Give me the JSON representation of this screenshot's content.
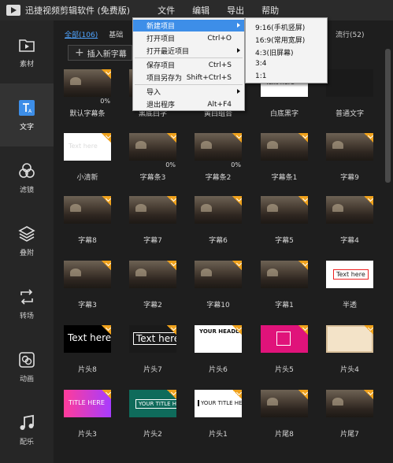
{
  "app": {
    "title": "迅捷视频剪辑软件 (免费版)"
  },
  "menu": [
    "文件",
    "编辑",
    "导出",
    "帮助"
  ],
  "sidebar": [
    {
      "label": "素材",
      "icon": "media-icon"
    },
    {
      "label": "文字",
      "icon": "text-icon",
      "active": true
    },
    {
      "label": "滤镜",
      "icon": "filter-icon"
    },
    {
      "label": "叠附",
      "icon": "overlay-icon"
    },
    {
      "label": "转场",
      "icon": "transition-icon"
    },
    {
      "label": "动画",
      "icon": "animation-icon"
    },
    {
      "label": "配乐",
      "icon": "music-icon"
    }
  ],
  "tabs": {
    "all": "全部(106)",
    "basic": "基础",
    "popular": "流行(52)"
  },
  "insert_button": "插入新字幕",
  "file_menu": [
    {
      "label": "新建项目",
      "submenu": true,
      "highlighted": true
    },
    {
      "label": "打开项目",
      "shortcut": "Ctrl+O"
    },
    {
      "label": "打开最近项目",
      "submenu": true
    },
    {
      "label": "保存项目",
      "shortcut": "Ctrl+S"
    },
    {
      "label": "项目另存为",
      "shortcut": "Shift+Ctrl+S"
    },
    {
      "label": "导入",
      "submenu": true
    },
    {
      "label": "退出程序",
      "shortcut": "Alt+F4"
    }
  ],
  "new_project_submenu": [
    "9:16(手机竖屏)",
    "16:9(常用宽屏)",
    "4:3(旧屏幕)",
    "3:4",
    "1:1"
  ],
  "tiles": [
    {
      "label": "默认字幕条",
      "style": "scene",
      "badge": true,
      "progress": "0%"
    },
    {
      "label": "黑底白字",
      "style": "scene",
      "badge": false
    },
    {
      "label": "黄白组合",
      "style": "scene",
      "badge": false
    },
    {
      "label": "白底黑字",
      "style": "white",
      "overlay": "Text here",
      "overlay_style": "black",
      "badge": false
    },
    {
      "label": "普通文字",
      "style": "dark",
      "badge": false
    },
    {
      "label": "小清新",
      "style": "white",
      "overlay": "Text here",
      "overlay_style": "light",
      "badge": true
    },
    {
      "label": "字幕条3",
      "style": "scene",
      "badge": true,
      "progress": "0%"
    },
    {
      "label": "字幕条2",
      "style": "scene",
      "badge": true,
      "progress": "0%"
    },
    {
      "label": "字幕条1",
      "style": "scene",
      "badge": true
    },
    {
      "label": "字幕9",
      "style": "scene",
      "badge": true
    },
    {
      "label": "字幕8",
      "style": "scene",
      "badge": true
    },
    {
      "label": "字幕7",
      "style": "scene",
      "badge": true
    },
    {
      "label": "字幕6",
      "style": "scene",
      "badge": true
    },
    {
      "label": "字幕5",
      "style": "scene",
      "badge": true
    },
    {
      "label": "字幕4",
      "style": "scene",
      "badge": true
    },
    {
      "label": "字幕3",
      "style": "scene",
      "badge": true
    },
    {
      "label": "字幕2",
      "style": "scene",
      "badge": true
    },
    {
      "label": "字幕10",
      "style": "scene",
      "badge": true
    },
    {
      "label": "字幕1",
      "style": "scene",
      "badge": true
    },
    {
      "label": "半透",
      "style": "white",
      "overlay": "Text here",
      "overlay_style": "red",
      "badge": false
    },
    {
      "label": "片头8",
      "style": "black",
      "overlay": "Text here",
      "overlay_style": "big",
      "badge": true
    },
    {
      "label": "片头7",
      "style": "dark",
      "overlay": "Text here",
      "overlay_style": "outline-big",
      "badge": true
    },
    {
      "label": "片头6",
      "style": "white",
      "overlay": "YOUR HEADLINE HERE",
      "overlay_style": "stack",
      "badge": true
    },
    {
      "label": "片头5",
      "style": "pink",
      "badge": true
    },
    {
      "label": "片头4",
      "style": "paper",
      "badge": true
    },
    {
      "label": "片头3",
      "style": "grad",
      "overlay": "TITLE HERE",
      "overlay_style": "small",
      "badge": true
    },
    {
      "label": "片头2",
      "style": "green",
      "overlay": "YOUR TITLE HERE",
      "overlay_style": "outline",
      "badge": true
    },
    {
      "label": "片头1",
      "style": "white",
      "overlay": "YOUR TITLE HERE",
      "overlay_style": "titlebox",
      "badge": true
    },
    {
      "label": "片尾8",
      "style": "scene",
      "badge": true
    },
    {
      "label": "片尾7",
      "style": "scene",
      "badge": true
    }
  ]
}
